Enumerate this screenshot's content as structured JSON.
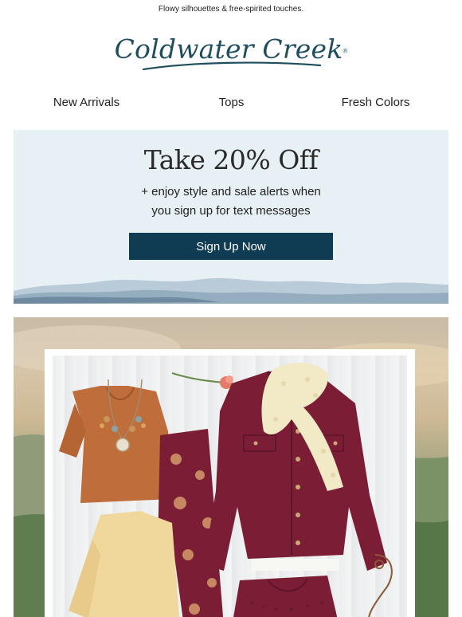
{
  "preheader": "Flowy silhouettes & free-spirited touches.",
  "logo": {
    "text": "Coldwater Creek",
    "mark": "®"
  },
  "nav": [
    {
      "label": "New Arrivals"
    },
    {
      "label": "Tops"
    },
    {
      "label": "Fresh Colors"
    }
  ],
  "promo": {
    "title": "Take 20% Off",
    "subtitle_line1": "+ enjoy style and sale alerts when",
    "subtitle_line2": "you sign up for text messages",
    "button": "Sign Up Now"
  },
  "hero": {
    "image": "outfit flat-lay: rust crinkle top with statement necklace, burgundy denim jacket, cream lace scarf, burgundy floral pants, butter yellow tunic, pink flower"
  },
  "colors": {
    "brand": "#1f4e5c",
    "button": "#0f3b53",
    "promo_bg": "#e7f0f5",
    "burgundy": "#7b1d35",
    "rust": "#bf6d3a"
  }
}
